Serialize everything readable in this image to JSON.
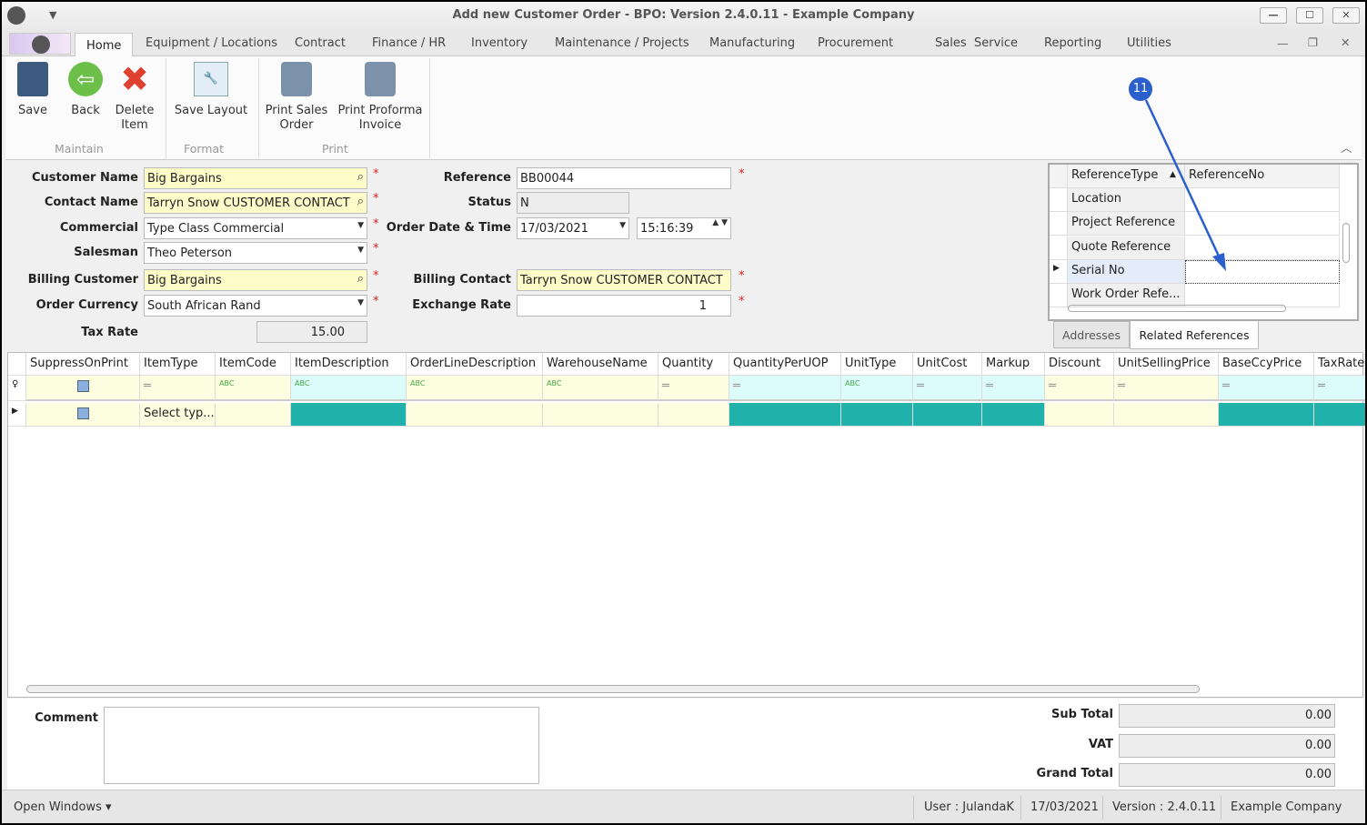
{
  "window": {
    "title": "Add new Customer Order - BPO: Version 2.4.0.11 - Example Company"
  },
  "menu_tabs": [
    "Home",
    "Equipment / Locations",
    "Contract",
    "Finance / HR",
    "Inventory",
    "Maintenance / Projects",
    "Manufacturing",
    "Procurement",
    "Sales",
    "Service",
    "Reporting",
    "Utilities"
  ],
  "ribbon": {
    "save": "Save",
    "back": "Back",
    "delete": [
      "Delete",
      "Item"
    ],
    "save_layout": "Save Layout",
    "print_sales": [
      "Print Sales",
      "Order"
    ],
    "print_proforma": [
      "Print Proforma",
      "Invoice"
    ],
    "groups": {
      "maintain": "Maintain",
      "format": "Format",
      "print": "Print"
    }
  },
  "form": {
    "customer_name": {
      "label": "Customer Name",
      "value": "Big Bargains"
    },
    "contact_name": {
      "label": "Contact Name",
      "value": "Tarryn Snow CUSTOMER CONTACT"
    },
    "commercial": {
      "label": "Commercial",
      "value": "Type Class Commercial"
    },
    "salesman": {
      "label": "Salesman",
      "value": "Theo Peterson"
    },
    "billing_customer": {
      "label": "Billing Customer",
      "value": "Big Bargains"
    },
    "order_currency": {
      "label": "Order Currency",
      "value": "South African Rand"
    },
    "tax_rate": {
      "label": "Tax Rate",
      "value": "15.00"
    },
    "reference": {
      "label": "Reference",
      "value": "BB00044"
    },
    "status": {
      "label": "Status",
      "value": "N"
    },
    "order_date": {
      "label": "Order Date & Time",
      "date": "17/03/2021",
      "time": "15:16:39"
    },
    "billing_contact": {
      "label": "Billing Contact",
      "value": "Tarryn Snow CUSTOMER CONTACT"
    },
    "exchange_rate": {
      "label": "Exchange Rate",
      "value": "1"
    },
    "required_mark": "*"
  },
  "references": {
    "headers": [
      "ReferenceType",
      "ReferenceNo"
    ],
    "rows": [
      "Location",
      "Project Reference",
      "Quote Reference",
      "Serial No",
      "Work Order Refe..."
    ],
    "selected": 3,
    "tabs": [
      "Addresses",
      "Related References"
    ],
    "active_tab": 1
  },
  "annotation": {
    "badge": "11",
    "color": "#2b5fce"
  },
  "grid": {
    "columns": [
      {
        "name": "SuppressOnPrint",
        "filter": "check",
        "ro": false
      },
      {
        "name": "ItemType",
        "filter": "=",
        "ro": false,
        "value": "Select typ..."
      },
      {
        "name": "ItemCode",
        "filter": "abc",
        "ro": false
      },
      {
        "name": "ItemDescription",
        "filter": "abc",
        "ro": true
      },
      {
        "name": "OrderLineDescription",
        "filter": "abc",
        "ro": false
      },
      {
        "name": "WarehouseName",
        "filter": "abc",
        "ro": false
      },
      {
        "name": "Quantity",
        "filter": "=",
        "ro": false
      },
      {
        "name": "QuantityPerUOP",
        "filter": "=",
        "ro": true
      },
      {
        "name": "UnitType",
        "filter": "abc",
        "ro": true
      },
      {
        "name": "UnitCost",
        "filter": "=",
        "ro": true
      },
      {
        "name": "Markup",
        "filter": "=",
        "ro": true
      },
      {
        "name": "Discount",
        "filter": "=",
        "ro": false
      },
      {
        "name": "UnitSellingPrice",
        "filter": "=",
        "ro": false
      },
      {
        "name": "BaseCcyPrice",
        "filter": "=",
        "ro": true
      },
      {
        "name": "TaxRate",
        "filter": "=",
        "ro": true
      }
    ],
    "colors": {
      "readonly": "#20b2aa",
      "filter_ro": "#dcfcfc",
      "editable": "#fdfde0"
    }
  },
  "footer": {
    "comment_label": "Comment",
    "sub_total": {
      "label": "Sub Total",
      "value": "0.00"
    },
    "vat": {
      "label": "VAT",
      "value": "0.00"
    },
    "grand_total": {
      "label": "Grand Total",
      "value": "0.00"
    }
  },
  "statusbar": {
    "open_windows": "Open Windows ▾",
    "user": "User : JulandaK",
    "date": "17/03/2021",
    "version": "Version : 2.4.0.11",
    "company": "Example Company"
  }
}
